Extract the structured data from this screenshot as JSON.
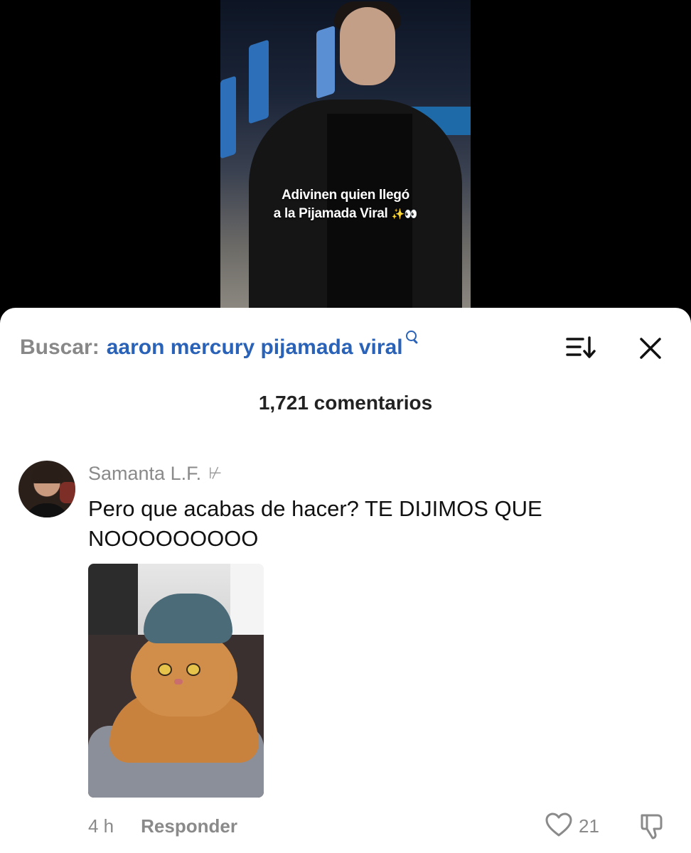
{
  "video": {
    "caption_line1": "Adivinen quien llegó",
    "caption_line2": "a la Pijamada Viral",
    "caption_emoji": "✨👀"
  },
  "search": {
    "prefix": "Buscar:",
    "query": "aaron mercury pijamada viral",
    "icon": "search-icon",
    "accent": "#2a62b8"
  },
  "toolbar": {
    "sort_icon": "sort-icon",
    "close_icon": "close-icon"
  },
  "comments_header": {
    "count_label": "1,721 comentarios"
  },
  "comment": {
    "username": "Samanta L.F.",
    "relation_glyph": "⊬",
    "text": "Pero que acabas de hacer? TE DIJIMOS QUE NOOOOOOOOO",
    "image_description": "",
    "timestamp": "4 h",
    "reply_label": "Responder",
    "likes": "21",
    "like_icon": "heart-icon",
    "dislike_icon": "thumbs-down-icon"
  }
}
